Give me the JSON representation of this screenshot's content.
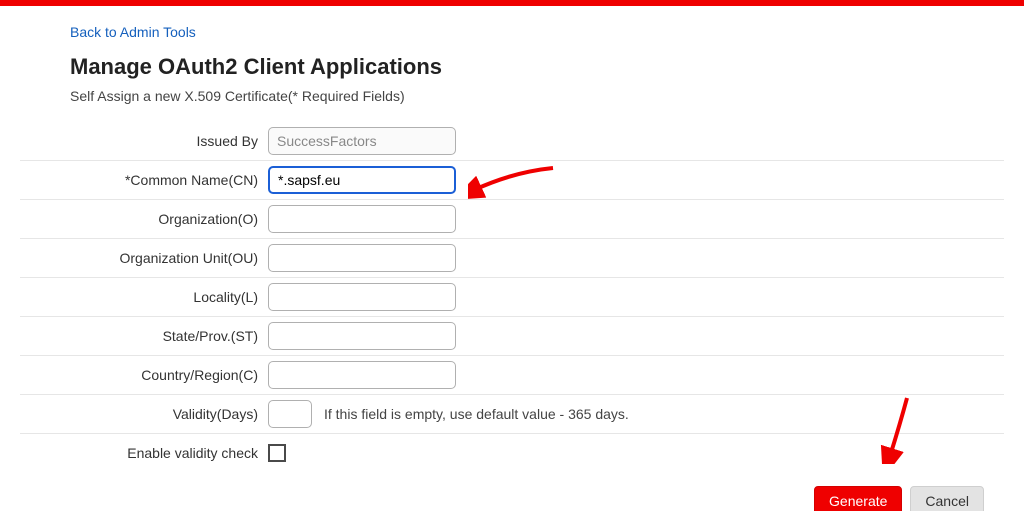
{
  "back_link": "Back to Admin Tools",
  "title": "Manage OAuth2 Client Applications",
  "subtitle": "Self Assign a new X.509 Certificate(* Required Fields)",
  "labels": {
    "issued_by": "Issued By",
    "common_name": "*Common Name(CN)",
    "organization": "Organization(O)",
    "organization_unit": "Organization Unit(OU)",
    "locality": "Locality(L)",
    "state": "State/Prov.(ST)",
    "country": "Country/Region(C)",
    "validity": "Validity(Days)",
    "enable_validity": "Enable validity check"
  },
  "values": {
    "issued_by": "SuccessFactors",
    "common_name": "*.sapsf.eu",
    "organization": "",
    "organization_unit": "",
    "locality": "",
    "state": "",
    "country": "",
    "validity": ""
  },
  "hint_validity": "If this field is empty, use default value - 365 days.",
  "buttons": {
    "generate": "Generate",
    "cancel": "Cancel"
  }
}
